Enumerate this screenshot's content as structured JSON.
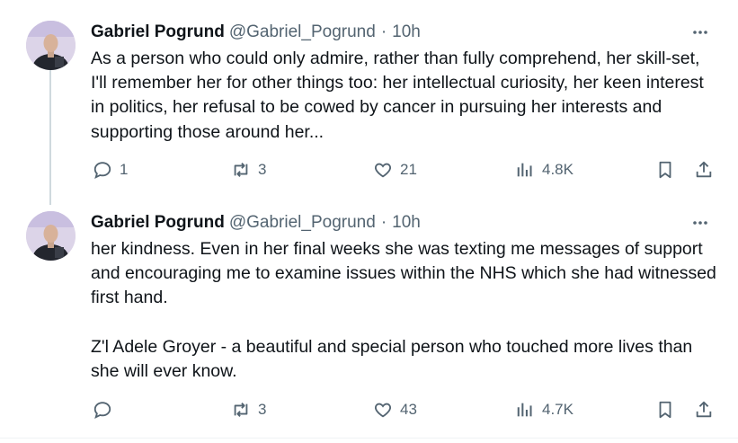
{
  "tweets": [
    {
      "author_name": "Gabriel Pogrund",
      "handle": "@Gabriel_Pogrund",
      "separator": "·",
      "time": "10h",
      "text": "As a person who could only admire, rather than fully comprehend, her skill-set, I'll remember her for other things too: her intellectual curiosity, her keen interest in politics, her refusal to be cowed by cancer in pursuing her interests and supporting those around her...",
      "replies": "1",
      "reposts": "3",
      "likes": "21",
      "views": "4.8K"
    },
    {
      "author_name": "Gabriel Pogrund",
      "handle": "@Gabriel_Pogrund",
      "separator": "·",
      "time": "10h",
      "text": "her kindness. Even in her final weeks she was texting me messages of support and encouraging me to examine issues within the NHS which she had witnessed first hand.\n\nZ'l Adele Groyer - a beautiful and special person who touched more lives than she will ever know.",
      "replies": "",
      "reposts": "3",
      "likes": "43",
      "views": "4.7K"
    }
  ],
  "colors": {
    "text": "#0f1419",
    "secondary": "#536471",
    "thread_line": "#cfd9de",
    "border": "#eff3f4"
  },
  "icons": [
    "reply-icon",
    "repost-icon",
    "like-icon",
    "views-icon",
    "bookmark-icon",
    "share-icon",
    "more-icon"
  ]
}
